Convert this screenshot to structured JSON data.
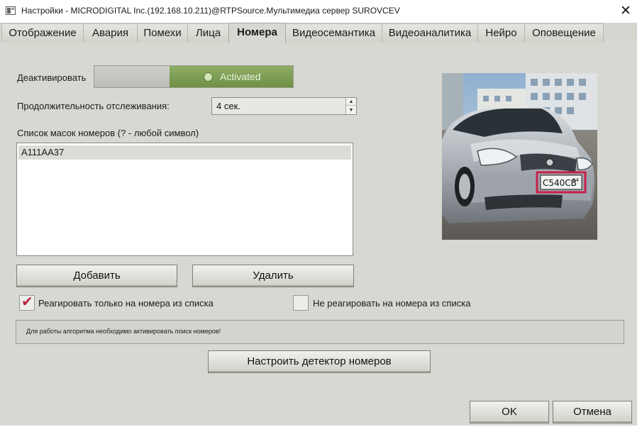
{
  "window": {
    "title": "Настройки - MICRODIGITAL Inc.(192.168.10.211)@RTPSource.Мультимедиа сервер SUROVCEV",
    "close_glyph": "✕"
  },
  "tabs": [
    {
      "label": "Отображение",
      "active": false
    },
    {
      "label": "Авария",
      "active": false
    },
    {
      "label": "Помехи",
      "active": false
    },
    {
      "label": "Лица",
      "active": false
    },
    {
      "label": "Номера",
      "active": true
    },
    {
      "label": "Видеосемантика",
      "active": false
    },
    {
      "label": "Видеоаналитика",
      "active": false
    },
    {
      "label": "Нейро",
      "active": false
    },
    {
      "label": "Оповещение",
      "active": false
    }
  ],
  "settings": {
    "deactivate_label": "Деактивировать",
    "toggle_state_label": "Activated",
    "tracking_duration_label": "Продолжительность отслеживания:",
    "tracking_duration_value": "4 сек.",
    "masks_list_label": "Список масок номеров (? - любой символ)",
    "masks": [
      "А111АА37"
    ],
    "add_button": "Добавить",
    "delete_button": "Удалить",
    "only_from_list_label": "Реагировать только на номера из списка",
    "only_from_list_checked": true,
    "not_from_list_label": "Не реагировать на номера из списка",
    "not_from_list_checked": false,
    "info_text": "Для работы алгоритма необходимо активировать поиск номеров!",
    "configure_detector_button": "Настроить детектор номеров"
  },
  "preview": {
    "plate_text": "C540CB",
    "plate_region": "64",
    "plate_highlight_color": "#c8204a"
  },
  "footer": {
    "ok_button": "OK",
    "cancel_button": "Отмена"
  },
  "colors": {
    "accent_green": "#7a9a50",
    "panel_bg": "#d8d8d2",
    "checkmark": "#b8263c"
  }
}
